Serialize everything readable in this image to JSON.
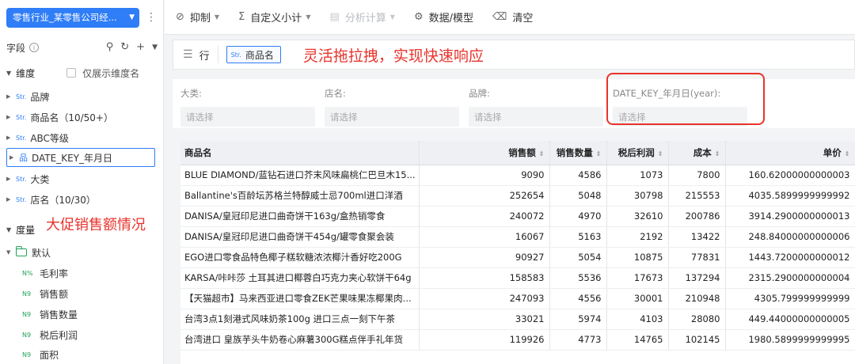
{
  "datasource": {
    "name": "零售行业_某零售公司经..."
  },
  "fields_panel": {
    "title": "字段",
    "info": "i",
    "dimension_group": "维度",
    "only_dim_name": "仅展示维度名",
    "dimensions": [
      {
        "type": "Str.",
        "label": "品牌"
      },
      {
        "type": "Str.",
        "label": "商品名（10/50+）"
      },
      {
        "type": "Str.",
        "label": "ABC等级"
      },
      {
        "type": "hier",
        "label": "DATE_KEY_年月日"
      },
      {
        "type": "Str.",
        "label": "大类"
      },
      {
        "type": "Str.",
        "label": "店名（10/30）"
      }
    ],
    "measure_group": "度量",
    "measure_folder": "默认",
    "measures": [
      {
        "type": "N%",
        "label": "毛利率"
      },
      {
        "type": "N9",
        "label": "销售额"
      },
      {
        "type": "N9",
        "label": "销售数量"
      },
      {
        "type": "N9",
        "label": "税后利润"
      },
      {
        "type": "N9",
        "label": "面积"
      }
    ]
  },
  "annotations": {
    "left": "大促销售额情况",
    "top": "灵活拖拉拽，实现快速响应"
  },
  "toolbar": {
    "suppress": "抑制",
    "custom_subtotal": "自定义小计",
    "analysis_calc": "分析计算",
    "data_model": "数据/模型",
    "clear": "清空"
  },
  "row_shelf": {
    "label": "行",
    "pill_type": "Str.",
    "pill_label": "商品名"
  },
  "filters": [
    {
      "label": "大类:",
      "placeholder": "请选择"
    },
    {
      "label": "店名:",
      "placeholder": "请选择"
    },
    {
      "label": "品牌:",
      "placeholder": "请选择"
    },
    {
      "label": "DATE_KEY_年月日(year):",
      "placeholder": "请选择"
    }
  ],
  "table": {
    "columns": [
      "商品名",
      "销售额",
      "销售数量",
      "税后利润",
      "成本",
      "单价"
    ],
    "rows": [
      [
        "BLUE DIAMOND/蓝钻石进口芥末风味扁桃仁巴旦木15...",
        "9090",
        "4586",
        "1073",
        "7800",
        "160.62000000000003"
      ],
      [
        "Ballantine's百龄坛苏格兰特醇威士忌700ml进口洋酒",
        "252654",
        "5048",
        "30798",
        "215553",
        "4035.5899999999992"
      ],
      [
        "DANISA/皇冠印尼进口曲奇饼干163g/盒热销零食",
        "240072",
        "4970",
        "32610",
        "200786",
        "3914.2900000000013"
      ],
      [
        "DANISA/皇冠印尼进口曲奇饼干454g/罐零食聚会装",
        "16067",
        "5163",
        "2192",
        "13422",
        "248.84000000000006"
      ],
      [
        "EGO进口零食品特色椰子糕软糖浓浓椰汁香好吃200G",
        "90927",
        "5054",
        "10875",
        "77831",
        "1443.7200000000012"
      ],
      [
        "KARSA/咔咔莎 土耳其进口椰蓉白巧克力夹心软饼干64g",
        "158583",
        "5536",
        "17673",
        "137294",
        "2315.2900000000004"
      ],
      [
        "【天猫超市】马来西亚进口零食ZEK芒果味果冻椰果肉...",
        "247093",
        "4556",
        "30001",
        "210948",
        "4305.799999999999"
      ],
      [
        "台湾3点1刻港式风味奶茶100g 进口三点一刻下午茶",
        "33021",
        "5974",
        "4103",
        "28080",
        "449.44000000000005"
      ],
      [
        "台湾进口 皇族芋头牛奶卷心麻薯300G糕点伴手礼年货",
        "119926",
        "4773",
        "14765",
        "102145",
        "1980.5899999999995"
      ]
    ]
  }
}
